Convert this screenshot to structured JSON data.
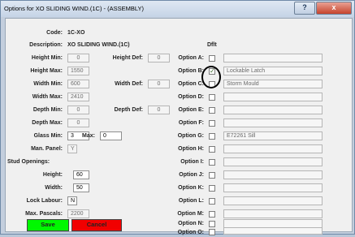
{
  "window": {
    "title": "Options for XO SLIDING WIND.(1C) - (ASSEMBLY)",
    "help_label": "?",
    "close_label": "x"
  },
  "form": {
    "code": {
      "label": "Code:",
      "value": "1C-XO"
    },
    "description": {
      "label": "Description:",
      "value": "XO SLIDING WIND.(1C)"
    },
    "height_min": {
      "label": "Height Min:",
      "value": "0"
    },
    "height_max": {
      "label": "Height Max:",
      "value": "1550"
    },
    "width_min": {
      "label": "Width Min:",
      "value": "600"
    },
    "width_max": {
      "label": "Width Max:",
      "value": "2410"
    },
    "depth_min": {
      "label": "Depth Min:",
      "value": "0"
    },
    "depth_max": {
      "label": "Depth Max:",
      "value": "0"
    },
    "glass_min": {
      "label": "Glass Min:",
      "value": "3"
    },
    "man_panel": {
      "label": "Man. Panel:",
      "value": "Y"
    },
    "stud_openings": {
      "label": "Stud Openings:"
    },
    "height": {
      "label": "Height:",
      "value": "60"
    },
    "width": {
      "label": "Width:",
      "value": "50"
    },
    "lock_labour": {
      "label": "Lock Labour:",
      "value": "N"
    },
    "max_pascals": {
      "label": "Max. Pascals:",
      "value": "2200"
    },
    "height_def": {
      "label": "Height Def:",
      "value": "0"
    },
    "width_def": {
      "label": "Width Def:",
      "value": "0"
    },
    "depth_def": {
      "label": "Depth Def:",
      "value": "0"
    },
    "max": {
      "label": "Max:",
      "value": "0"
    }
  },
  "options": {
    "dflt_header": "Dflt",
    "items": [
      {
        "label": "Option A:",
        "checked": false,
        "value": ""
      },
      {
        "label": "Option B:",
        "checked": true,
        "value": "Lockable Latch"
      },
      {
        "label": "Option C:",
        "checked": false,
        "value": "Storm Mould"
      },
      {
        "label": "Option D:",
        "checked": false,
        "value": ""
      },
      {
        "label": "Option E:",
        "checked": false,
        "value": ""
      },
      {
        "label": "Option F:",
        "checked": false,
        "value": ""
      },
      {
        "label": "Option G:",
        "checked": false,
        "value": "E72261 Sill"
      },
      {
        "label": "Option H:",
        "checked": false,
        "value": ""
      },
      {
        "label": "Option I:",
        "checked": false,
        "value": ""
      },
      {
        "label": "Option J:",
        "checked": false,
        "value": ""
      },
      {
        "label": "Option K:",
        "checked": false,
        "value": ""
      },
      {
        "label": "Option L:",
        "checked": false,
        "value": ""
      },
      {
        "label": "Option M:",
        "checked": false,
        "value": ""
      },
      {
        "label": "Option N:",
        "checked": false,
        "value": ""
      },
      {
        "label": "Option O:",
        "checked": false,
        "value": ""
      }
    ]
  },
  "buttons": {
    "save": "Save",
    "cancel": "Cancel"
  },
  "colors": {
    "save": "#00f800",
    "cancel": "#f10000",
    "check": "#3a6a2a"
  }
}
